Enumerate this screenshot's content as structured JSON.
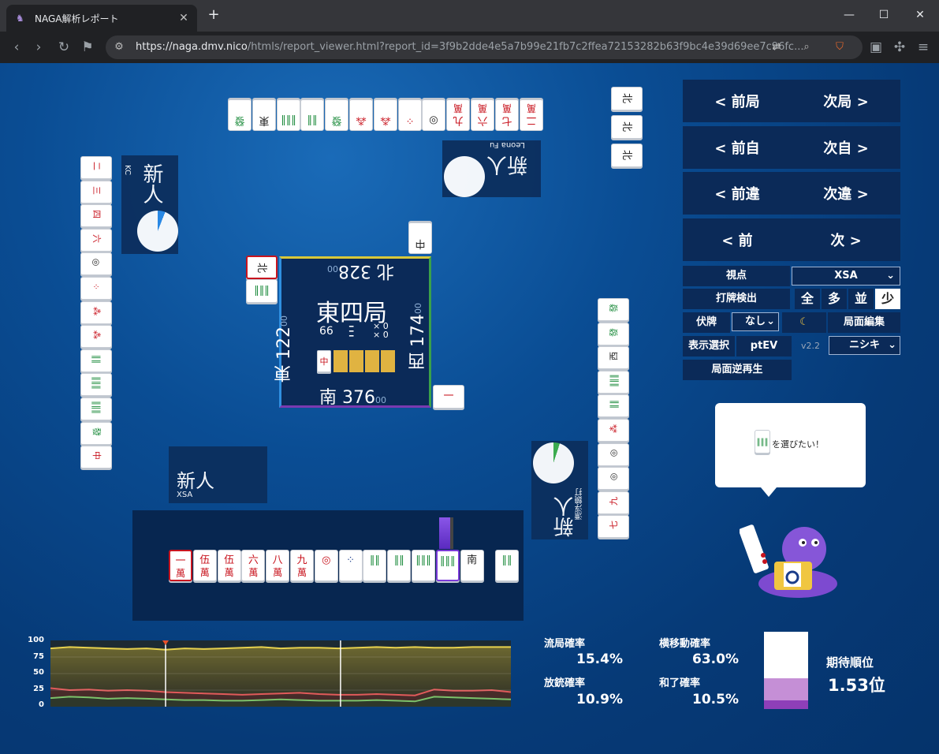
{
  "browser": {
    "tab_title": "NAGA解析レポート",
    "url_host": "https://naga.dmv.nico",
    "url_rest": "/htmls/report_viewer.html?report_id=3f9b2dde4e5a7b99e21fb7c2ffea72153282b63f9bc4e39d69ee7c96fc..."
  },
  "nav": {
    "prev_round": "< 前局",
    "next_round": "次局 >",
    "prev_self": "< 前自",
    "next_self": "次自 >",
    "prev_diff": "< 前違",
    "next_diff": "次違 >",
    "prev": "< 前",
    "next": "次 >"
  },
  "controls": {
    "viewpoint_label": "視点",
    "viewpoint_value": "XSA",
    "detect_label": "打牌検出",
    "detect_opts": [
      "全",
      "多",
      "並",
      "少"
    ],
    "fuku_label": "伏牌",
    "fuku_value": "なし",
    "moon": "☾",
    "edit_label": "局面編集",
    "display_label": "表示選択",
    "ptev": "ptEV",
    "version": "v2.2",
    "model_value": "ニシキ",
    "replay_label": "局面逆再生"
  },
  "center": {
    "round": "東四局",
    "north": "北 328",
    "north_sub": "00",
    "east": "東 122",
    "east_sub": "00",
    "west": "西 174",
    "west_sub": "00",
    "south": "南 376",
    "south_sub": "00",
    "wall_count": "66",
    "honba": "× 0",
    "riichi": "× 0",
    "dora": "中"
  },
  "players": {
    "self": {
      "rank": "新人",
      "name": "XSA"
    },
    "left": {
      "rank": "新人",
      "name": "KC"
    },
    "top": {
      "rank": "新人",
      "name": "Leona Fu"
    },
    "right": {
      "rank": "新人",
      "name": "漂浮鏡打"
    }
  },
  "hand": [
    {
      "v": "一",
      "s": "萬",
      "c": "r",
      "hl": true
    },
    {
      "v": "伍",
      "s": "萬",
      "c": "r"
    },
    {
      "v": "伍",
      "s": "萬",
      "c": "r"
    },
    {
      "v": "六",
      "s": "萬",
      "c": "r"
    },
    {
      "v": "八",
      "s": "萬",
      "c": "r"
    },
    {
      "v": "九",
      "s": "萬",
      "c": "r"
    },
    {
      "v": "◎",
      "s": "",
      "c": "r"
    },
    {
      "v": "⁘",
      "s": "",
      "c": "b"
    },
    {
      "v": "‖‖",
      "s": "",
      "c": "g"
    },
    {
      "v": "‖‖",
      "s": "",
      "c": "g"
    },
    {
      "v": "‖‖‖",
      "s": "",
      "c": "g"
    },
    {
      "v": "‖‖‖",
      "s": "",
      "c": "g",
      "pick": true
    },
    {
      "v": "南",
      "s": "",
      "c": "k"
    }
  ],
  "draw_tile": {
    "v": "‖‖",
    "s": "",
    "c": "g"
  },
  "top_discards": [
    "發",
    "東",
    "‖‖‖",
    "‖‖",
    "發",
    "⁂",
    "⁂",
    "⁘",
    "◎",
    "九",
    "六",
    "七",
    "二"
  ],
  "top_discard_suits": [
    "",
    "",
    "",
    "",
    "",
    "",
    "",
    "",
    "",
    "萬",
    "萬",
    "萬",
    "萬"
  ],
  "left_discards": [
    "二",
    "三",
    "四",
    "六",
    "◎",
    "⁘",
    "⁂",
    "⁂",
    "‖‖",
    "‖‖‖",
    "‖‖‖",
    "發",
    "中"
  ],
  "left_discard_suits": [
    "萬",
    "萬",
    "萬",
    "萬",
    "",
    "",
    "",
    "",
    "",
    "",
    "",
    "",
    ""
  ],
  "right_discards": [
    "發",
    "發",
    "西",
    "‖‖‖",
    "‖‖",
    "⁂",
    "◎",
    "◎",
    "九",
    "七"
  ],
  "right_discard_suits": [
    "",
    "",
    "",
    "",
    "",
    "",
    "",
    "",
    "萬",
    "萬"
  ],
  "north_melds": [
    "北",
    "北",
    "北"
  ],
  "left_kita": "北",
  "top_kita": "中",
  "right_kita": "一",
  "speech": {
    "text": "を選びたい！"
  },
  "stats": {
    "ryukyoku_label": "流局確率",
    "ryukyoku": "15.4%",
    "yoko_label": "横移動確率",
    "yoko": "63.0%",
    "houju_label": "放銃確率",
    "houju": "10.9%",
    "hora_label": "和了確率",
    "hora": "10.5%",
    "expected_label": "期待順位",
    "expected": "1.53位"
  },
  "chart_data": {
    "type": "area",
    "ylim": [
      0,
      100
    ],
    "yticks": [
      "100",
      "75",
      "50",
      "25",
      "0"
    ],
    "series": [
      {
        "values": [
          88,
          90,
          89,
          88,
          87,
          88,
          86,
          88,
          87,
          88,
          89,
          90,
          88,
          89,
          89,
          88,
          89,
          90,
          89,
          90,
          89,
          89,
          90,
          90,
          90
        ]
      },
      {
        "values": [
          28,
          25,
          26,
          24,
          25,
          24,
          22,
          21,
          20,
          19,
          18,
          19,
          20,
          21,
          19,
          18,
          18,
          19,
          18,
          17,
          26,
          24,
          24,
          25,
          22
        ]
      },
      {
        "values": [
          13,
          15,
          14,
          12,
          13,
          12,
          11,
          10,
          10,
          9,
          9,
          10,
          11,
          10,
          9,
          9,
          9,
          10,
          9,
          8,
          15,
          14,
          13,
          12,
          11
        ]
      }
    ]
  }
}
